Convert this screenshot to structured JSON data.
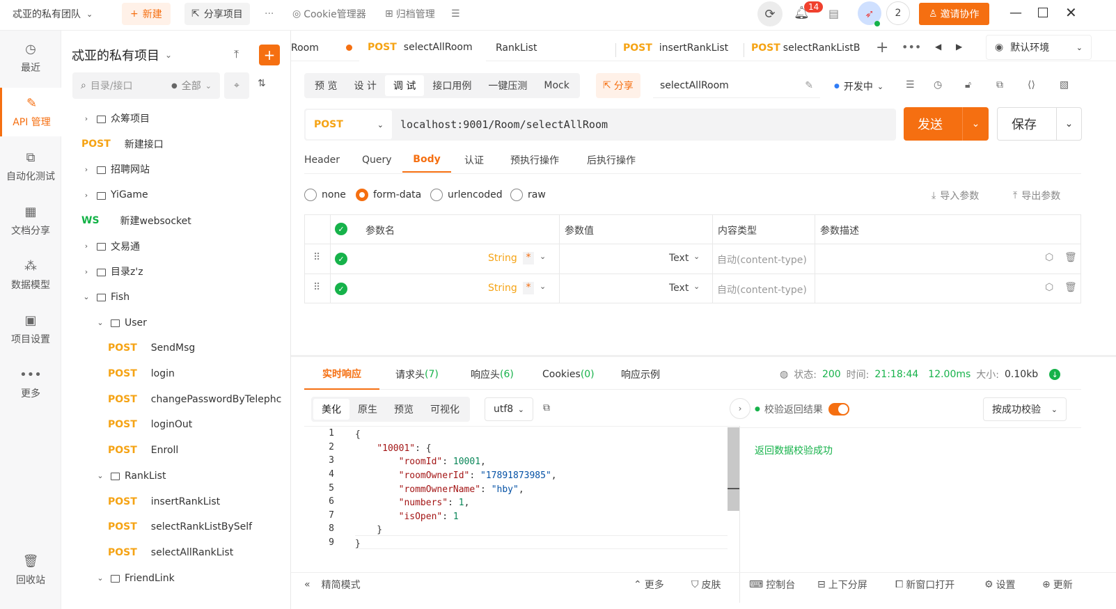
{
  "topbar": {
    "team": "忒亚的私有团队",
    "new_btn": "新建",
    "share_btn": "分享项目",
    "more": "···",
    "cookie": "Cookie管理器",
    "archive": "归档管理",
    "badge": "14",
    "user_count": "2",
    "invite": "邀请协作"
  },
  "rail": [
    {
      "label": "最近",
      "icon": "clock-icon"
    },
    {
      "label": "API 管理",
      "icon": "api-icon",
      "active": true
    },
    {
      "label": "自动化测试",
      "icon": "flow-icon"
    },
    {
      "label": "文档分享",
      "icon": "doc-icon"
    },
    {
      "label": "数据模型",
      "icon": "model-icon"
    },
    {
      "label": "项目设置",
      "icon": "settings-icon"
    },
    {
      "label": "更多",
      "icon": "more-icon"
    },
    {
      "label": "回收站",
      "icon": "trash-icon"
    }
  ],
  "tree": {
    "project_title": "忒亚的私有项目",
    "search_placeholder": "目录/接口",
    "filter": "全部",
    "items": [
      {
        "type": "folder",
        "label": "众筹项目"
      },
      {
        "type": "post",
        "method": "POST",
        "label": "新建接口"
      },
      {
        "type": "folder",
        "label": "招聘网站"
      },
      {
        "type": "folder",
        "label": "YiGame"
      },
      {
        "type": "ws",
        "method": "WS",
        "label": "新建websocket"
      },
      {
        "type": "folder",
        "label": "文易通"
      },
      {
        "type": "folder",
        "label": "目录z'z"
      },
      {
        "type": "folder-open",
        "label": "Fish"
      },
      {
        "type": "folder-open",
        "label": "User"
      },
      {
        "type": "post",
        "method": "POST",
        "label": "SendMsg"
      },
      {
        "type": "post",
        "method": "POST",
        "label": "login"
      },
      {
        "type": "post",
        "method": "POST",
        "label": "changePasswordByTelephc"
      },
      {
        "type": "post",
        "method": "POST",
        "label": "loginOut"
      },
      {
        "type": "post",
        "method": "POST",
        "label": "Enroll"
      },
      {
        "type": "folder-open",
        "label": "RankList"
      },
      {
        "type": "post",
        "method": "POST",
        "label": "insertRankList"
      },
      {
        "type": "post",
        "method": "POST",
        "label": "selectRankListBySelf"
      },
      {
        "type": "post",
        "method": "POST",
        "label": "selectAllRankList"
      },
      {
        "type": "folder-open",
        "label": "FriendLink"
      }
    ]
  },
  "tabs": [
    {
      "method": "",
      "label": "Room"
    },
    {
      "method": "POST",
      "label": "selectAllRoom",
      "active": true
    },
    {
      "method": "",
      "label": "RankList"
    },
    {
      "method": "POST",
      "label": "insertRankList"
    },
    {
      "method": "POST",
      "label": "selectRankListB"
    }
  ],
  "env": "默认环境",
  "modes": [
    "预 览",
    "设 计",
    "调 试",
    "接口用例",
    "一键压测",
    "Mock"
  ],
  "active_mode": "调 试",
  "share": "分享",
  "api_name": "selectAllRoom",
  "status": "开发中",
  "request": {
    "method": "POST",
    "url": "localhost:9001/Room/selectAllRoom",
    "send": "发送",
    "save": "保存"
  },
  "req_tabs": [
    "Header",
    "Query",
    "Body",
    "认证",
    "预执行操作",
    "后执行操作"
  ],
  "active_req_tab": "Body",
  "body_types": [
    "none",
    "form-data",
    "urlencoded",
    "raw"
  ],
  "active_body_type": "form-data",
  "import_params": "导入参数",
  "export_params": "导出参数",
  "param_headers": [
    "参数名",
    "参数值",
    "内容类型",
    "参数描述"
  ],
  "params": [
    {
      "type": "String",
      "required": "*",
      "value_type": "Text",
      "content_type": "自动(content-type)"
    },
    {
      "type": "String",
      "required": "*",
      "value_type": "Text",
      "content_type": "自动(content-type)"
    }
  ],
  "resp_tabs": [
    {
      "label": "实时响应",
      "count": ""
    },
    {
      "label": "请求头",
      "count": "(7)"
    },
    {
      "label": "响应头",
      "count": "(6)"
    },
    {
      "label": "Cookies",
      "count": "(0)"
    },
    {
      "label": "响应示例",
      "count": ""
    }
  ],
  "resp_meta": {
    "status_label": "状态:",
    "status": "200",
    "time_label": "时间:",
    "time": "21:18:44",
    "duration": "12.00ms",
    "size_label": "大小:",
    "size": "0.10kb"
  },
  "view_modes": [
    "美化",
    "原生",
    "预览",
    "可视化"
  ],
  "encoding": "utf8",
  "verify_label": "校验返回结果",
  "verify_mode": "按成功校验",
  "verify_result": "返回数据校验成功",
  "code_lines": [
    "1",
    "2",
    "3",
    "4",
    "5",
    "6",
    "7",
    "8",
    "9"
  ],
  "bottom": {
    "simple": "精简模式",
    "more": "更多",
    "skin": "皮肤",
    "console": "控制台",
    "split": "上下分屏",
    "newwin": "新窗口打开",
    "settings": "设置",
    "update": "更新"
  }
}
